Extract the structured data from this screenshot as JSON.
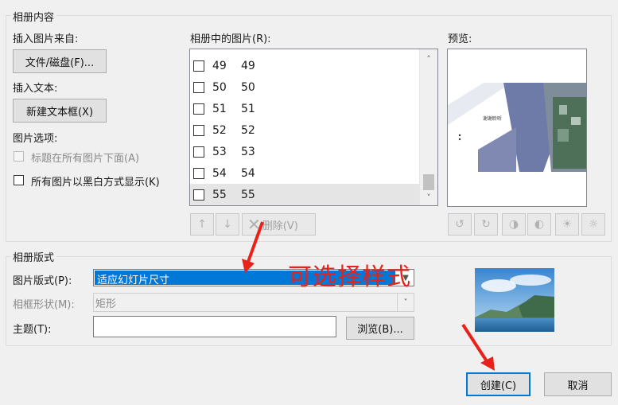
{
  "album_content": {
    "group_title": "相册内容",
    "insert_picture_from": "插入图片来自:",
    "file_disk_button": "文件/磁盘(F)...",
    "insert_text": "插入文本:",
    "new_textbox_button": "新建文本框(X)",
    "picture_options": "图片选项:",
    "caption_below": "标题在所有图片下面(A)",
    "all_black_white": "所有图片以黑白方式显示(K)",
    "pictures_in_album": "相册中的图片(R):",
    "preview": "预览:",
    "items": [
      {
        "num": "49",
        "name": "49",
        "selected": false
      },
      {
        "num": "50",
        "name": "50",
        "selected": false
      },
      {
        "num": "51",
        "name": "51",
        "selected": false
      },
      {
        "num": "52",
        "name": "52",
        "selected": false
      },
      {
        "num": "53",
        "name": "53",
        "selected": false
      },
      {
        "num": "54",
        "name": "54",
        "selected": false
      },
      {
        "num": "55",
        "name": "55",
        "selected": true
      }
    ],
    "remove_button": "删除(V)",
    "preview_slide_text": "谢谢聆听"
  },
  "album_layout": {
    "group_title": "相册版式",
    "picture_layout_label": "图片版式(P):",
    "picture_layout_value": "适应幻灯片尺寸",
    "frame_shape_label": "相框形状(M):",
    "frame_shape_value": "矩形",
    "theme_label": "主题(T):",
    "theme_value": "",
    "browse_button": "浏览(B)..."
  },
  "annotation": {
    "text": "可选择样式",
    "color": "#e8221a"
  },
  "footer": {
    "create_button": "创建(C)",
    "cancel_button": "取消"
  },
  "icons": [
    "up-arrow-icon",
    "down-arrow-icon",
    "remove-x-icon",
    "rotate-left-icon",
    "rotate-right-icon",
    "contrast-increase-icon",
    "contrast-decrease-icon",
    "brightness-increase-icon",
    "brightness-decrease-icon"
  ]
}
